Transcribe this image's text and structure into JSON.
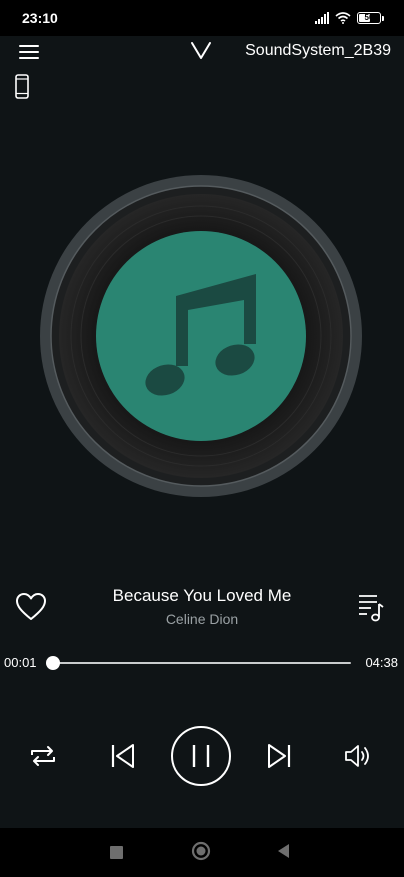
{
  "status_bar": {
    "time": "23:10",
    "battery_level": "56",
    "battery_fraction": 0.56
  },
  "header": {
    "device_name": "SoundSystem_2B39"
  },
  "now_playing": {
    "title": "Because You Loved Me",
    "artist": "Celine Dion",
    "liked": false
  },
  "progress": {
    "current": "00:01",
    "total": "04:38",
    "fraction": 0.0
  },
  "controls": {
    "state": "playing"
  },
  "colors": {
    "background": "#0f1416",
    "album_art": "#2a8572",
    "note": "#1b4a42",
    "disc": "#1a1a1a"
  },
  "icons": [
    "hamburger-menu-icon",
    "chevron-down-icon",
    "phone-icon",
    "heart-outline-icon",
    "playlist-icon",
    "repeat-icon",
    "skip-previous-icon",
    "pause-icon",
    "skip-next-icon",
    "volume-icon",
    "square-icon",
    "circle-icon",
    "triangle-back-icon"
  ]
}
